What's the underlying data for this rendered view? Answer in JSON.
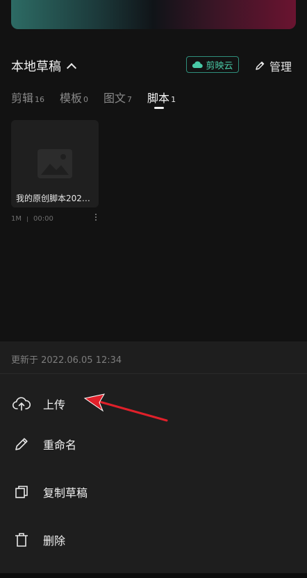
{
  "drafts": {
    "section_title": "本地草稿",
    "cloud_button": "剪映云",
    "manage_button": "管理",
    "tabs": [
      {
        "label": "剪辑",
        "count": "16"
      },
      {
        "label": "模板",
        "count": "0"
      },
      {
        "label": "图文",
        "count": "7"
      },
      {
        "label": "脚本",
        "count": "1"
      }
    ],
    "active_tab": "脚本",
    "card": {
      "title": "我的原创脚本202…",
      "size": "1M",
      "duration": "00:00"
    }
  },
  "sheet": {
    "updated": "更新于 2022.06.05 12:34",
    "actions": [
      {
        "label": "上传",
        "icon": "cloud-upload-icon"
      },
      {
        "label": "重命名",
        "icon": "pencil-icon"
      },
      {
        "label": "复制草稿",
        "icon": "copy-icon"
      },
      {
        "label": "删除",
        "icon": "trash-icon"
      }
    ]
  },
  "colors": {
    "accent": "#49c9a6",
    "annotation_arrow": "#e0202a"
  }
}
